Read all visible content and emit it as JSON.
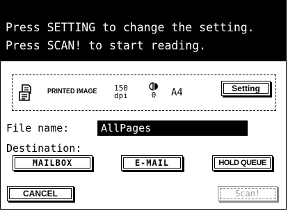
{
  "message": {
    "line1": "Press SETTING to change the setting.",
    "line2": "Press SCAN! to start reading."
  },
  "scan_settings": {
    "mode": "PRINTED IMAGE",
    "resolution": "150",
    "resolution_unit": "dpi",
    "contrast": "0",
    "paper_size": "A4",
    "setting_button": "Setting"
  },
  "file": {
    "label": "File name:",
    "value": "AllPages"
  },
  "destination": {
    "label": "Destination:",
    "mailbox": "MAILBOX",
    "email": "E-MAIL",
    "hold_queue": "HOLD QUEUE"
  },
  "actions": {
    "cancel": "CANCEL",
    "scan": "Scan!"
  },
  "icons": {
    "document": "document-icon",
    "contrast": "contrast-icon"
  }
}
